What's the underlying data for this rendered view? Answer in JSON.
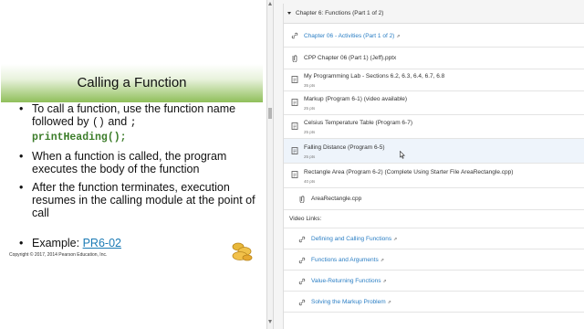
{
  "slide": {
    "title": "Calling a Function",
    "bullet1_text": "To call a function, use the function name followed by",
    "bullet1_code": "()",
    "bullet1_and": "and",
    "bullet1_semicolon": ";",
    "bullet1_example_code": "printHeading();",
    "bullet2": "When a function is called, the program executes the body of the function",
    "bullet3": "After the function terminates, execution resumes in the calling module at the point of call",
    "example_label": "Example:",
    "example_link": "PR6-02",
    "copyright": "Copyright © 2017, 2014 Pearson Education, Inc."
  },
  "module": {
    "title": "Chapter 6: Functions (Part 1 of 2)",
    "items": [
      {
        "title": "Chapter 06 - Activities (Part 1 of 2)",
        "pts": "",
        "icon": "link-icon",
        "link": true,
        "external": true
      },
      {
        "title": "CPP Chapter 06 (Part 1) (Jeff).pptx",
        "pts": "",
        "icon": "attachment-icon",
        "link": false,
        "external": false
      },
      {
        "title": "My Programming Lab - Sections 6.2, 6.3, 6.4, 6.7, 6.8",
        "pts": "35 pts",
        "icon": "assignment-icon",
        "link": false,
        "external": false
      },
      {
        "title": "Markup (Program 6-1) (video available)",
        "pts": "25 pts",
        "icon": "assignment-icon",
        "link": false,
        "external": false
      },
      {
        "title": "Celsius Temperature Table (Program 6-7)",
        "pts": "25 pts",
        "icon": "assignment-icon",
        "link": false,
        "external": false
      },
      {
        "title": "Falling Distance (Program 6-5)",
        "pts": "25 pts",
        "icon": "assignment-icon",
        "link": false,
        "external": false
      },
      {
        "title": "Rectangle Area (Program 6-2) (Complete Using Starter File AreaRectangle.cpp)",
        "pts": "40 pts",
        "icon": "assignment-icon",
        "link": false,
        "external": false
      },
      {
        "title": "AreaRectangle.cpp",
        "pts": "",
        "icon": "attachment-icon",
        "link": false,
        "external": false
      },
      {
        "title": "Video Links:",
        "pts": "",
        "icon": "",
        "link": false,
        "external": false
      },
      {
        "title": "Defining and Calling Functions",
        "pts": "",
        "icon": "link-icon",
        "link": true,
        "external": true
      },
      {
        "title": "Functions and Arguments",
        "pts": "",
        "icon": "link-icon",
        "link": true,
        "external": true
      },
      {
        "title": "Value-Returning Functions",
        "pts": "",
        "icon": "link-icon",
        "link": true,
        "external": true
      },
      {
        "title": "Solving the Markup Problem",
        "pts": "",
        "icon": "link-icon",
        "link": true,
        "external": true
      }
    ],
    "external_glyph": "⇗"
  }
}
